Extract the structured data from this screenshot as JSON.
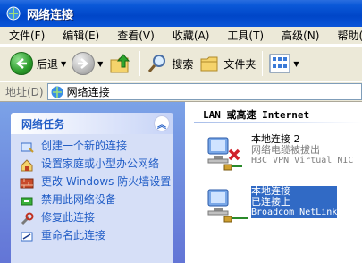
{
  "window": {
    "title": "网络连接"
  },
  "menu": [
    {
      "label": "文件(F)"
    },
    {
      "label": "编辑(E)"
    },
    {
      "label": "查看(V)"
    },
    {
      "label": "收藏(A)"
    },
    {
      "label": "工具(T)"
    },
    {
      "label": "高级(N)"
    },
    {
      "label": "帮助(H)"
    }
  ],
  "toolbar": {
    "back_label": "后退",
    "search_label": "搜索",
    "folders_label": "文件夹"
  },
  "address": {
    "label": "地址(D)",
    "value": "网络连接"
  },
  "tasks": {
    "title": "网络任务",
    "items": [
      {
        "label": "创建一个新的连接",
        "icon": "new-connection-icon"
      },
      {
        "label": "设置家庭或小型办公网络",
        "icon": "home-network-icon"
      },
      {
        "label": "更改 Windows 防火墙设置",
        "icon": "firewall-icon"
      },
      {
        "label": "禁用此网络设备",
        "icon": "disable-device-icon"
      },
      {
        "label": "修复此连接",
        "icon": "repair-icon"
      },
      {
        "label": "重命名此连接",
        "icon": "rename-icon"
      }
    ]
  },
  "group": {
    "title": "LAN 或高速 Internet"
  },
  "connections": [
    {
      "name": "本地连接 2",
      "status": "网络电缆被拔出",
      "device": "H3C VPN Virtual NIC",
      "selected": false
    },
    {
      "name": "本地连接",
      "status": "已连接上",
      "device": "Broadcom NetLink",
      "selected": true
    }
  ],
  "colors": {
    "titlebar": "#0a58d8",
    "task_link": "#215dc6",
    "selection": "#316ac5"
  }
}
